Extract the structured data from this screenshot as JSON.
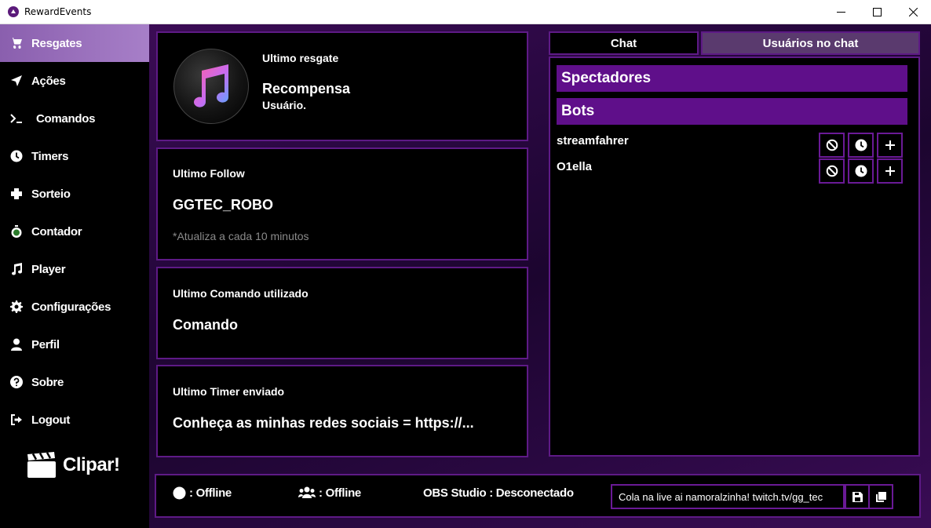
{
  "window": {
    "title": "RewardEvents"
  },
  "sidebar": {
    "items": [
      {
        "label": "Resgates",
        "icon": "cart-icon",
        "active": true
      },
      {
        "label": "Ações",
        "icon": "location-arrow-icon"
      },
      {
        "label": "Comandos",
        "icon": "terminal-icon"
      },
      {
        "label": "Timers",
        "icon": "clock-icon"
      },
      {
        "label": "Sorteio",
        "icon": "puzzle-icon"
      },
      {
        "label": "Contador",
        "icon": "stopwatch-icon"
      },
      {
        "label": "Player",
        "icon": "music-note-icon"
      },
      {
        "label": "Configurações",
        "icon": "gear-icon"
      },
      {
        "label": "Perfil",
        "icon": "user-icon"
      },
      {
        "label": "Sobre",
        "icon": "question-icon"
      },
      {
        "label": "Logout",
        "icon": "sign-out-icon"
      }
    ],
    "clip_label": "Clipar!"
  },
  "cards": {
    "last_redeem": {
      "label": "Ultimo resgate",
      "reward": "Recompensa",
      "user": "Usuário."
    },
    "last_follow": {
      "label": "Ultimo Follow",
      "value": "GGTEC_ROBO",
      "hint": "*Atualiza a cada 10 minutos"
    },
    "last_command": {
      "label": "Ultimo Comando utilizado",
      "value": "Comando"
    },
    "last_timer": {
      "label": "Ultimo Timer enviado",
      "value": "Conheça as minhas redes sociais = https://..."
    }
  },
  "chat": {
    "tabs": [
      {
        "label": "Chat"
      },
      {
        "label": "Usuários no chat",
        "active": true
      }
    ],
    "groups": {
      "spectators": "Spectadores",
      "bots": "Bots"
    },
    "users": [
      {
        "name": "streamfahrer"
      },
      {
        "name": "O1ella"
      }
    ]
  },
  "status": {
    "stream": "Offline",
    "chat": "Offline",
    "obs_label": "OBS Studio",
    "obs_status": "Desconectado",
    "message_value": "Cola na live ai namoralzinha!  twitch.tv/gg_tec"
  },
  "colors": {
    "accent": "#5e1a86",
    "header": "#5f0f8a",
    "active_nav": "#9a70bd",
    "tab_active": "#5a3a6e"
  }
}
